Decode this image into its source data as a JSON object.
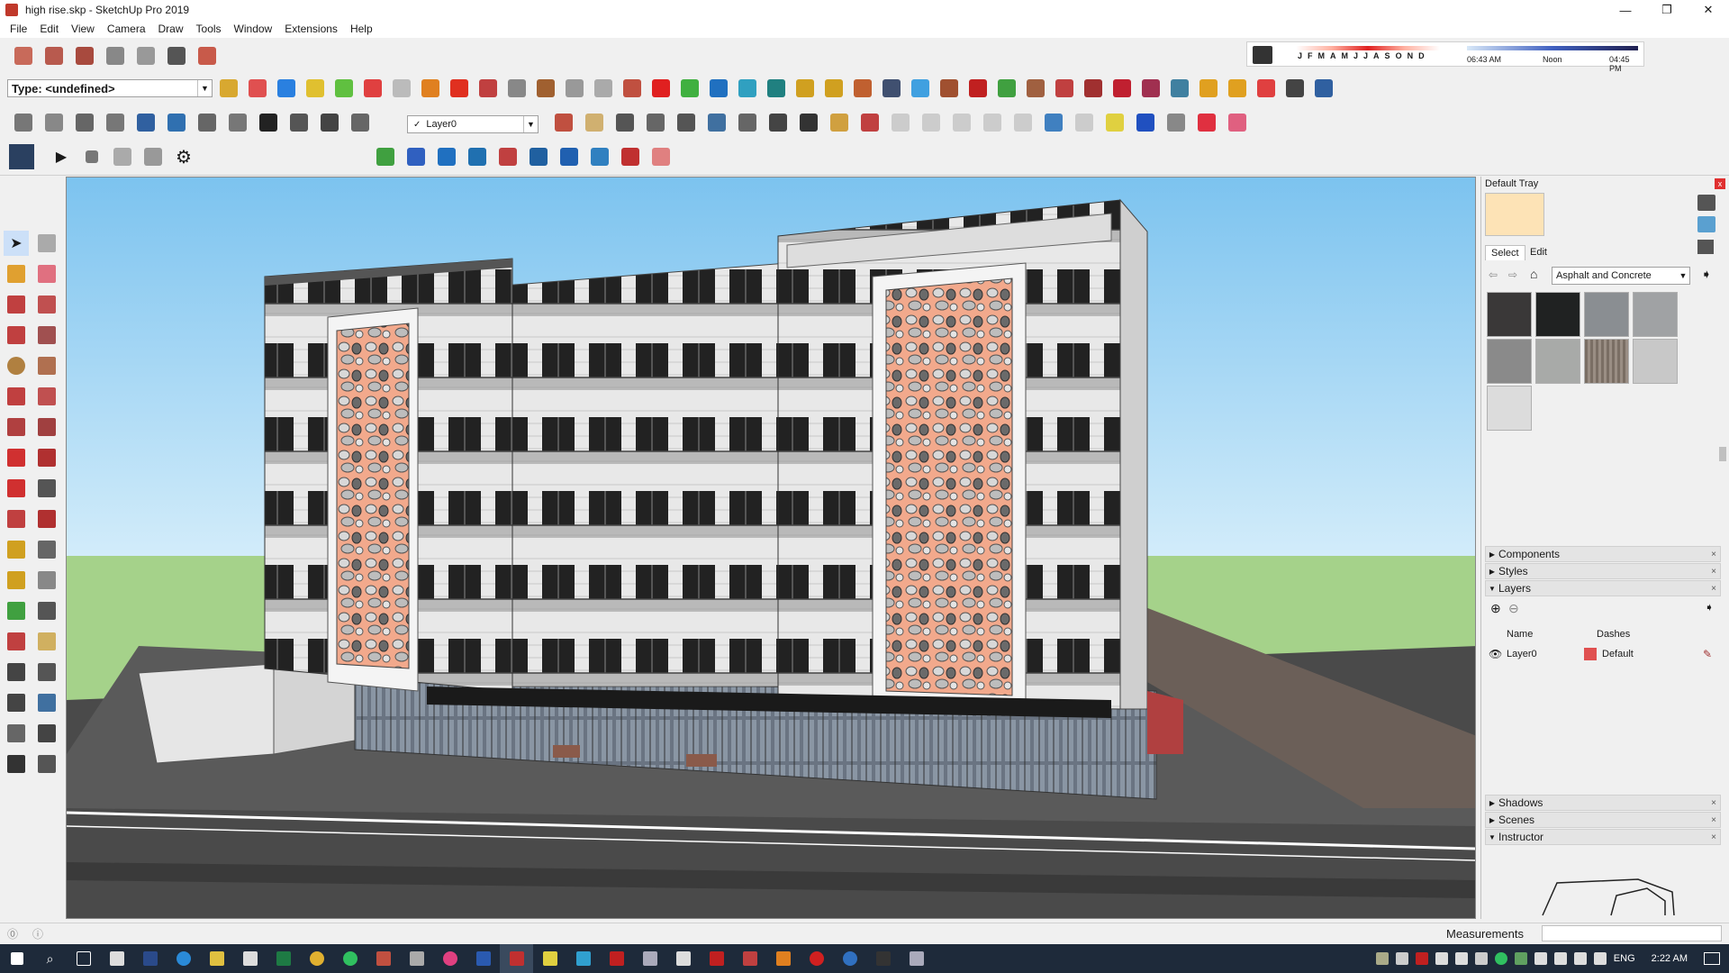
{
  "window": {
    "title": "high rise.skp - SketchUp Pro 2019",
    "min": "—",
    "max": "❐",
    "close": "✕"
  },
  "menu": [
    "File",
    "Edit",
    "View",
    "Camera",
    "Draw",
    "Tools",
    "Window",
    "Extensions",
    "Help"
  ],
  "entity_info": {
    "type_label": "Type: <undefined>"
  },
  "layer_toolbar": {
    "current_layer": "Layer0",
    "check": "✓"
  },
  "shadow_settings": {
    "months": [
      "J",
      "F",
      "M",
      "A",
      "M",
      "J",
      "J",
      "A",
      "S",
      "O",
      "N",
      "D"
    ],
    "time_start": "06:43 AM",
    "time_mid": "Noon",
    "time_end": "04:45 PM"
  },
  "tray": {
    "title": "Default Tray",
    "close": "x",
    "tabs": [
      "Select",
      "Edit"
    ],
    "material_collection": "Asphalt and Concrete",
    "swatch_colors": [
      "#3a3838",
      "#202222",
      "#8a8e92",
      "#a0a2a4",
      "#8a8a8a",
      "#a8aaa8",
      "#7a6e64",
      "#c8c8c8",
      "#dcdcdc"
    ],
    "panels_collapsed_top": [
      "Components",
      "Styles"
    ],
    "layers_panel": {
      "title": "Layers",
      "col_name": "Name",
      "col_dashes": "Dashes",
      "rows": [
        {
          "name": "Layer0",
          "dashes": "Default",
          "color": "#e05050"
        }
      ]
    },
    "panels_collapsed_bottom": [
      "Shadows",
      "Scenes"
    ],
    "instructor": "Instructor"
  },
  "status": {
    "measurements_label": "Measurements"
  },
  "taskbar": {
    "lang": "ENG",
    "time": "2:22 AM"
  },
  "colors": {
    "sky_top": "#7cc3ef",
    "sky_bottom": "#cfe8f8",
    "grass": "#a5d28a",
    "screen_panel": "#f2a98c"
  }
}
